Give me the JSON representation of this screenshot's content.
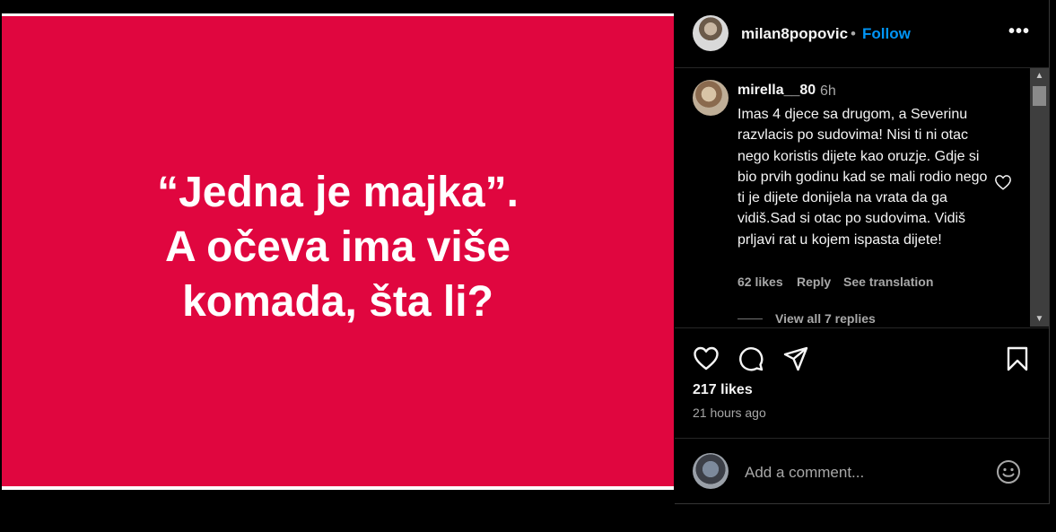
{
  "post": {
    "quote_line1": "“Jedna je majka”.",
    "quote_line2": "A očeva ima više",
    "quote_line3": "komada, šta li?",
    "background_color": "#e0063f"
  },
  "header": {
    "username": "milan8popovic",
    "separator": "•",
    "follow_label": "Follow",
    "more_label": "•••"
  },
  "comment": {
    "username": "mirella__80",
    "time": "6h",
    "text": "Imas 4 djece sa drugom, a Severinu razvlacis po sudovima! Nisi ti ni otac nego koristis dijete kao oruzje. Gdje si bio prvih godinu kad se mali rodio nego ti je dijete donijela na vrata da ga vidiš.Sad si otac po sudovima. Vidiš prljavi rat u kojem ispasta dijete!",
    "likes": "62 likes",
    "reply_label": "Reply",
    "translation_label": "See translation",
    "view_replies": "View all 7 replies"
  },
  "actions": {
    "icons": [
      "heart-icon",
      "comment-icon",
      "share-icon",
      "bookmark-icon"
    ]
  },
  "stats": {
    "likes": "217 likes",
    "time_ago": "21 hours ago"
  },
  "composer": {
    "placeholder": "Add a comment...",
    "value": ""
  }
}
